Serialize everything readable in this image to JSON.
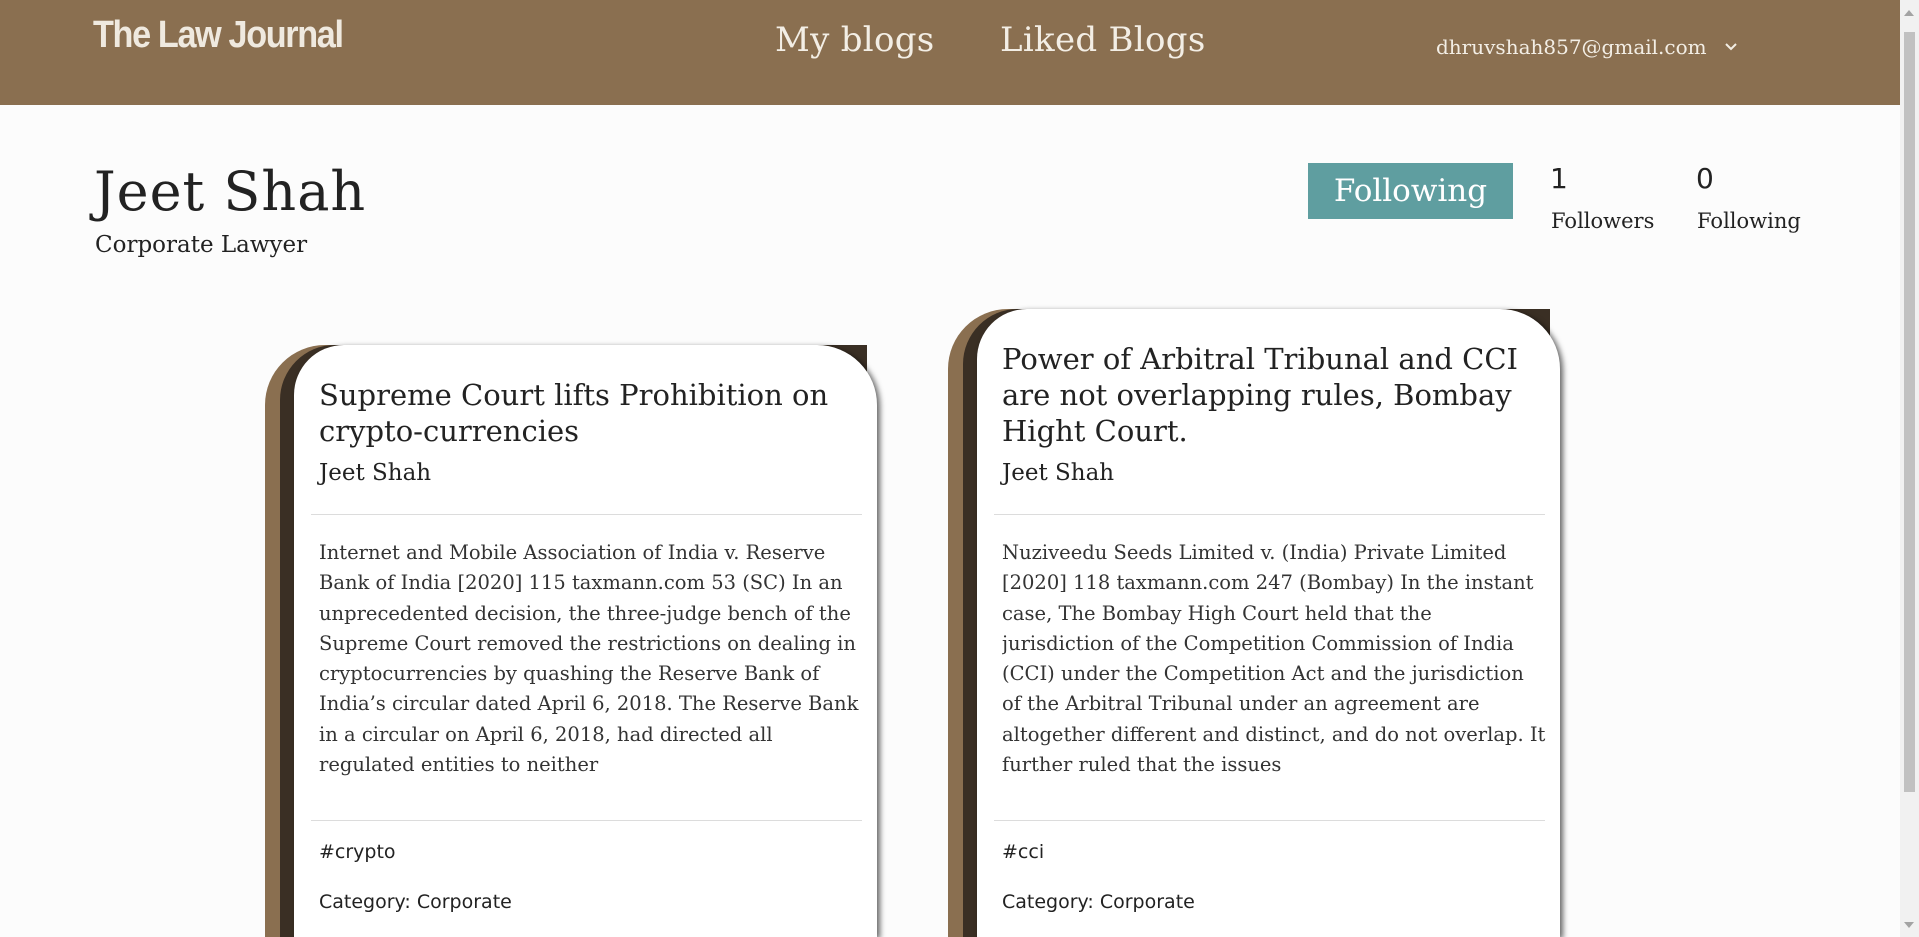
{
  "header": {
    "brand": "The Law Journal",
    "nav": [
      "My blogs",
      "Liked Blogs"
    ],
    "user_email": "dhruvshah857@gmail.com",
    "user_menu_icon": "chevron-down-icon",
    "background_color": "#8a6f50"
  },
  "profile": {
    "name": "Jeet Shah",
    "role": "Corporate Lawyer",
    "follow_button_label": "Following",
    "follow_button_color": "#5f9ea0",
    "followers_count": "1",
    "followers_label": "Followers",
    "following_count": "0",
    "following_label": "Following"
  },
  "posts": [
    {
      "title": "Supreme Court lifts Prohibition on crypto-currencies",
      "author": "Jeet Shah",
      "excerpt": "Internet and Mobile Association of India v. Reserve Bank of India [2020] 115 taxmann.com 53 (SC) In an unprecedented decision, the three-judge bench of the Supreme Court removed the restrictions on dealing in cryptocurrencies by quashing the Reserve Bank of India’s circular dated April 6, 2018. The Reserve Bank in a circular on April 6, 2018, had directed all regulated entities to neither",
      "tag": "#crypto",
      "category": "Category: Corporate"
    },
    {
      "title": "Power of Arbitral Tribunal and CCI are not overlapping rules, Bombay Hight Court.",
      "author": "Jeet Shah",
      "excerpt": "Nuziveedu Seeds Limited v. (India) Private Limited [2020] 118 taxmann.com 247 (Bombay) In the instant case, The Bombay High Court held that the jurisdiction of the Competition Commission of India (CCI) under the Competition Act and the jurisdiction of the Arbitral Tribunal under an agreement are altogether different and distinct, and do not overlap. It further ruled that the issues",
      "tag": "#cci",
      "category": "Category: Corporate"
    }
  ]
}
